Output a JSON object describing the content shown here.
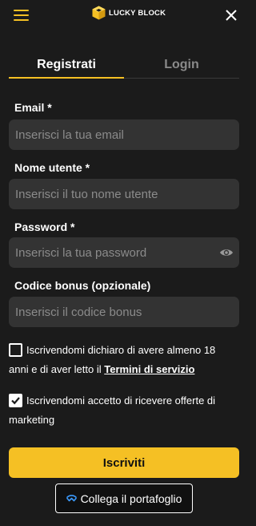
{
  "header": {
    "brand": "LUCKY BLOCK",
    "menu_icon": "hamburger-menu-icon",
    "close_icon": "close-icon"
  },
  "tabs": [
    {
      "label": "Registrati",
      "active": true
    },
    {
      "label": "Login",
      "active": false
    }
  ],
  "form": {
    "email": {
      "label": "Email *",
      "placeholder": "Inserisci la tua email",
      "value": ""
    },
    "username": {
      "label": "Nome utente *",
      "placeholder": "Inserisci il tuo nome utente",
      "value": ""
    },
    "password": {
      "label": "Password *",
      "placeholder": "Inserisci la tua password",
      "value": ""
    },
    "bonus": {
      "label": "Codice bonus (opzionale)",
      "placeholder": "Inserisci il codice bonus",
      "value": ""
    }
  },
  "consents": {
    "terms": {
      "checked": false,
      "text_line1": "Iscrivendomi dichiaro di avere almeno 18",
      "text_line2": "anni e di aver letto il ",
      "link": "Termini di servizio"
    },
    "marketing": {
      "checked": true,
      "text_line1": "Iscrivendomi accetto di ricevere offerte di",
      "text_line2": "marketing"
    }
  },
  "buttons": {
    "submit": "Iscriviti",
    "wallet": "Collega il portafoglio"
  },
  "colors": {
    "accent": "#f5c024",
    "background": "#1b1b1b",
    "field": "#333333",
    "placeholder": "#8b8b8b",
    "inactive_tab": "#8a8a8a"
  }
}
